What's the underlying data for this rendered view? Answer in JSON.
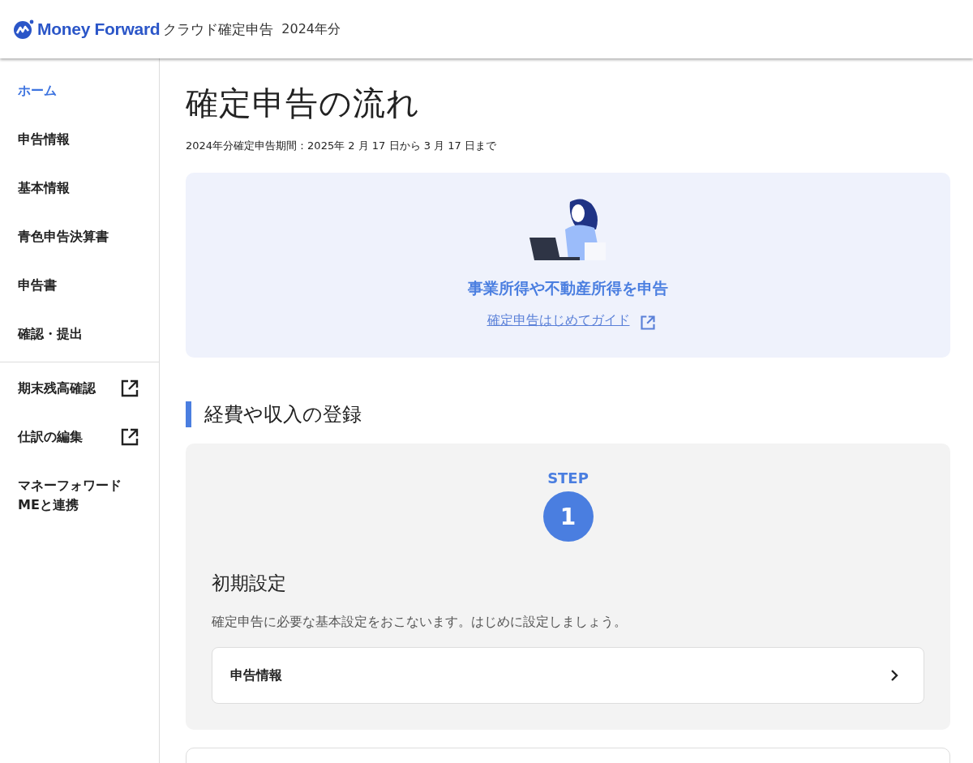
{
  "header": {
    "logo_text": "Money Forward",
    "product": "クラウド確定申告",
    "year": "2024年分"
  },
  "sidebar": {
    "items": [
      {
        "label": "ホーム",
        "selected": true
      },
      {
        "label": "申告情報",
        "selected": false
      },
      {
        "label": "基本情報",
        "selected": false
      },
      {
        "label": "青色申告決算書",
        "selected": false
      },
      {
        "label": "申告書",
        "selected": false
      },
      {
        "label": "確認・提出",
        "selected": false
      }
    ],
    "links": [
      {
        "label": "期末残高確認",
        "external": true
      },
      {
        "label": "仕訳の編集",
        "external": true
      },
      {
        "label": "マネーフォワードMEと連携",
        "external": false
      }
    ]
  },
  "main": {
    "title": "確定申告の流れ",
    "period": "2024年分確定申告期間：2025年 2 月 17 日から 3 月 17 日まで",
    "banner": {
      "heading": "事業所得や不動産所得を申告",
      "link": "確定申告はじめてガイド"
    },
    "section_title": "経費や収入の登録",
    "step": {
      "label": "STEP",
      "number": "1",
      "title": "初期設定",
      "description": "確定申告に必要な基本設定をおこないます。はじめに設定しましょう。",
      "rows": [
        {
          "label": "申告情報"
        }
      ]
    }
  }
}
